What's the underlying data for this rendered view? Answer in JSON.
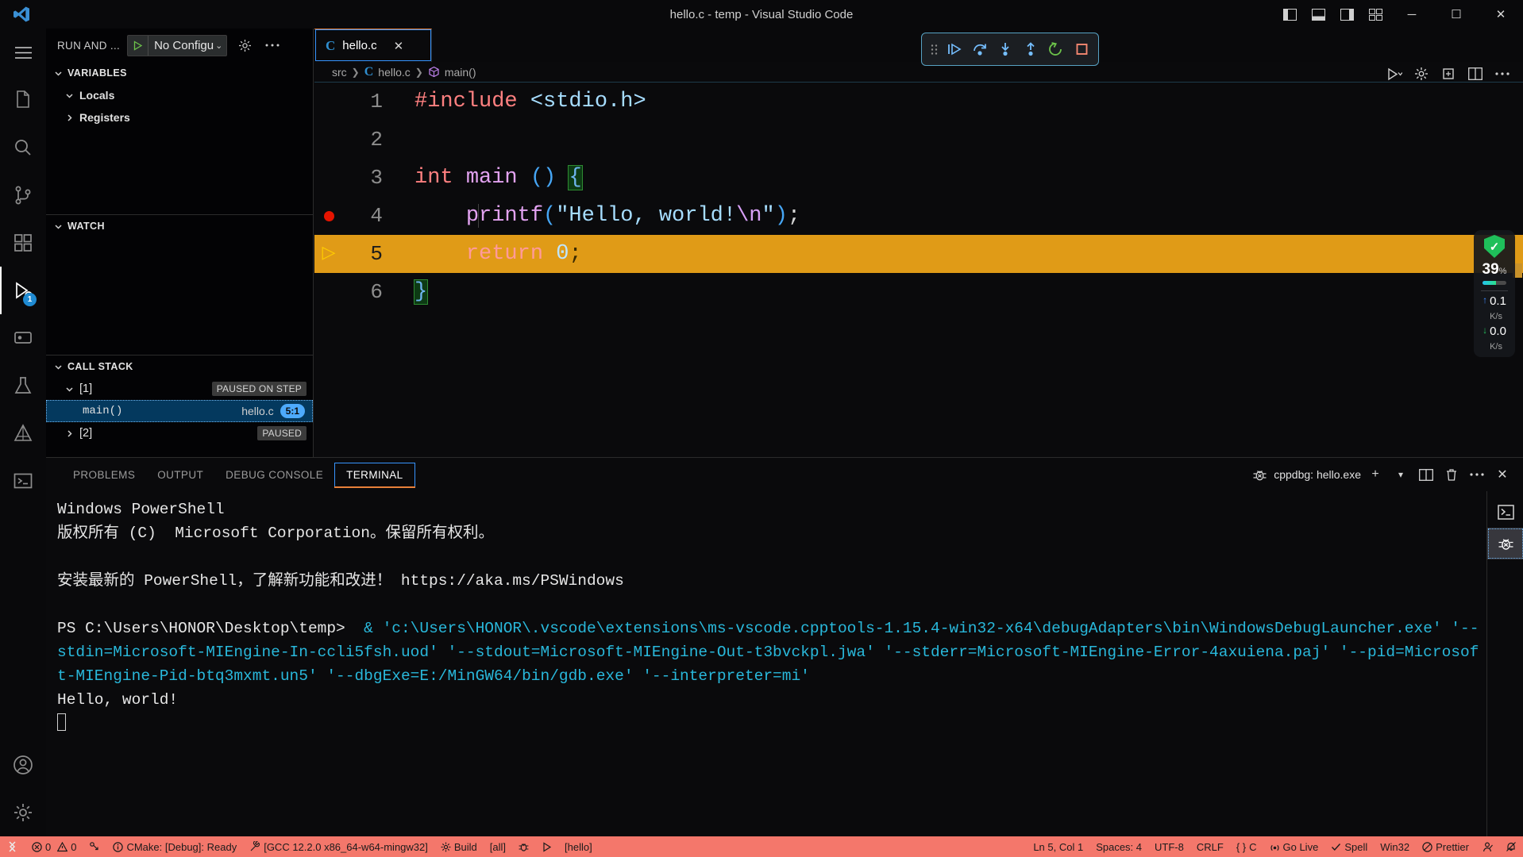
{
  "titlebar": {
    "title": "hello.c - temp - Visual Studio Code",
    "logo": "vscode-logo",
    "layout_buttons": [
      "toggle-primary-sidebar",
      "toggle-panel",
      "toggle-secondary-sidebar",
      "customize-layout"
    ],
    "window_buttons": {
      "minimize": "─",
      "maximize": "☐",
      "close": "✕"
    }
  },
  "activitybar": {
    "items": [
      {
        "name": "menu",
        "icon": "hamburger-icon"
      },
      {
        "name": "explorer",
        "icon": "files-icon"
      },
      {
        "name": "search",
        "icon": "search-icon"
      },
      {
        "name": "source-control",
        "icon": "source-control-icon"
      },
      {
        "name": "extensions",
        "icon": "extensions-icon"
      },
      {
        "name": "run-and-debug",
        "icon": "run-debug-icon",
        "badge": "1",
        "active": true
      },
      {
        "name": "remote-explorer",
        "icon": "remote-icon"
      },
      {
        "name": "testing",
        "icon": "beaker-icon"
      },
      {
        "name": "cmake",
        "icon": "cmake-icon"
      },
      {
        "name": "terminal-view",
        "icon": "terminal-icon"
      },
      {
        "name": "accounts",
        "icon": "account-icon"
      },
      {
        "name": "manage",
        "icon": "gear-icon"
      }
    ]
  },
  "sidebar": {
    "title": "RUN AND ...",
    "config": {
      "label": "No Configu",
      "play_icon": "play-icon",
      "caret": "⌄"
    },
    "header_icons": [
      "gear-icon",
      "more-actions-icon"
    ],
    "sections": [
      {
        "title": "VARIABLES",
        "rows": [
          {
            "label": "Locals",
            "expanded": true
          },
          {
            "label": "Registers",
            "expanded": false
          }
        ]
      },
      {
        "title": "WATCH",
        "rows": []
      },
      {
        "title": "CALL STACK",
        "rows": [
          {
            "label": "[1]",
            "expanded": true,
            "badge": "PAUSED ON STEP"
          },
          {
            "label": "main()",
            "file": "hello.c",
            "position": "5:1",
            "selected": true
          },
          {
            "label": "[2]",
            "expanded": false,
            "badge": "PAUSED"
          }
        ]
      }
    ]
  },
  "editor": {
    "tab": {
      "icon": "c-file-icon",
      "label": "hello.c",
      "close": "✕"
    },
    "breadcrumb": [
      "src",
      "hello.c",
      "main()"
    ],
    "breadcrumb_symbol_icon": "symbol-method-icon",
    "actions": [
      "run-or-debug-icon",
      "settings-gear-icon",
      "cmake-debug-icon",
      "split-editor-icon",
      "more-actions-icon"
    ],
    "lines": [
      {
        "num": "1",
        "marker": "",
        "tokens": [
          {
            "t": "#include ",
            "c": "t-pre"
          },
          {
            "t": "<stdio.h>",
            "c": "t-hdr"
          }
        ]
      },
      {
        "num": "2",
        "marker": "",
        "tokens": []
      },
      {
        "num": "3",
        "marker": "",
        "tokens": [
          {
            "t": "int ",
            "c": "t-kw"
          },
          {
            "t": "main ",
            "c": "t-fn"
          },
          {
            "t": "()",
            "c": "t-paren"
          },
          {
            "t": " ",
            "c": "t-punc"
          },
          {
            "t": "{",
            "c": "t-brace brace-match"
          }
        ]
      },
      {
        "num": "4",
        "marker": "breakpoint",
        "tokens": [
          {
            "t": "    ",
            "c": "t-punc"
          },
          {
            "t": "printf",
            "c": "t-fn"
          },
          {
            "t": "(",
            "c": "t-paren"
          },
          {
            "t": "\"Hello, world!",
            "c": "t-str"
          },
          {
            "t": "\\n",
            "c": "t-esc"
          },
          {
            "t": "\"",
            "c": "t-str"
          },
          {
            "t": ")",
            "c": "t-paren"
          },
          {
            "t": ";",
            "c": "t-punc"
          }
        ]
      },
      {
        "num": "5",
        "marker": "current-line-arrow",
        "highlight": true,
        "tokens": [
          {
            "t": "    ",
            "c": "t-punc"
          },
          {
            "t": "return ",
            "c": "t-kw"
          },
          {
            "t": "0",
            "c": "t-num"
          },
          {
            "t": ";",
            "c": "t-punc"
          }
        ]
      },
      {
        "num": "6",
        "marker": "",
        "tokens": [
          {
            "t": "}",
            "c": "t-brace brace-match"
          }
        ]
      }
    ]
  },
  "debug_toolbar": {
    "buttons": [
      {
        "name": "drag-handle",
        "icon": "grip-icon"
      },
      {
        "name": "continue",
        "icon": "continue-icon"
      },
      {
        "name": "step-over",
        "icon": "step-over-icon"
      },
      {
        "name": "step-into",
        "icon": "step-into-icon"
      },
      {
        "name": "step-out",
        "icon": "step-out-icon"
      },
      {
        "name": "restart",
        "icon": "restart-icon"
      },
      {
        "name": "stop",
        "icon": "stop-icon"
      }
    ]
  },
  "panel": {
    "tabs": [
      {
        "label": "PROBLEMS",
        "active": false
      },
      {
        "label": "OUTPUT",
        "active": false
      },
      {
        "label": "DEBUG CONSOLE",
        "active": false
      },
      {
        "label": "TERMINAL",
        "active": true
      }
    ],
    "session": {
      "icon": "debug-console-icon",
      "label": "cppdbg: hello.exe"
    },
    "actions": [
      "new-terminal-icon",
      "terminal-profile-chevron-icon",
      "split-terminal-icon",
      "kill-terminal-icon",
      "more-actions-icon",
      "close-panel-icon"
    ],
    "side_items": [
      {
        "name": "powershell-terminal",
        "icon": "terminal-icon",
        "active": false
      },
      {
        "name": "cppdbg-terminal",
        "icon": "debug-console-icon",
        "active": true
      }
    ],
    "terminal": {
      "line1": "Windows PowerShell",
      "line2": "版权所有 (C)  Microsoft Corporation。保留所有权利。",
      "line3": "",
      "line4": "安装最新的 PowerShell，了解新功能和改进！ https://aka.ms/PSWindows",
      "line5": "",
      "prompt": "PS C:\\Users\\HONOR\\Desktop\\temp> ",
      "command": " & 'c:\\Users\\HONOR\\.vscode\\extensions\\ms-vscode.cpptools-1.15.4-win32-x64\\debugAdapters\\bin\\WindowsDebugLauncher.exe' '--stdin=Microsoft-MIEngine-In-ccli5fsh.uod' '--stdout=Microsoft-MIEngine-Out-t3bvckpl.jwa' '--stderr=Microsoft-MIEngine-Error-4axuiena.paj' '--pid=Microsoft-MIEngine-Pid-btq3mxmt.un5' '--dbgExe=E:/MinGW64/bin/gdb.exe' '--interpreter=mi'",
      "output": "Hello, world!"
    }
  },
  "statusbar": {
    "left": [
      {
        "name": "remote-window",
        "icon": "remote-icon",
        "label": ""
      },
      {
        "name": "problems",
        "icon": "error-icon",
        "label": "0",
        "icon2": "warning-icon",
        "label2": "0"
      },
      {
        "name": "live-share",
        "icon": "live-share-icon",
        "label": ""
      },
      {
        "name": "cmake-status",
        "icon": "info-icon",
        "label": "CMake: [Debug]: Ready"
      },
      {
        "name": "cmake-kit",
        "icon": "tools-icon",
        "label": "[GCC 12.2.0 x86_64-w64-mingw32]"
      },
      {
        "name": "cmake-build",
        "icon": "gear-icon",
        "label": "Build"
      },
      {
        "name": "cmake-target-all",
        "icon": "",
        "label": "[all]"
      },
      {
        "name": "cmake-debug",
        "icon": "bug-icon",
        "label": ""
      },
      {
        "name": "cmake-launch",
        "icon": "play-icon",
        "label": ""
      },
      {
        "name": "cmake-launch-target",
        "icon": "",
        "label": "[hello]"
      }
    ],
    "right": [
      {
        "name": "editor-position",
        "icon": "",
        "label": "Ln 5, Col 1"
      },
      {
        "name": "indentation",
        "icon": "",
        "label": "Spaces: 4"
      },
      {
        "name": "encoding",
        "icon": "",
        "label": "UTF-8"
      },
      {
        "name": "eol",
        "icon": "",
        "label": "CRLF"
      },
      {
        "name": "language-mode",
        "icon": "brackets-icon",
        "label": "C"
      },
      {
        "name": "go-live",
        "icon": "broadcast-icon",
        "label": "Go Live"
      },
      {
        "name": "spell-checker",
        "icon": "check-icon",
        "label": "Spell"
      },
      {
        "name": "win32",
        "icon": "",
        "label": "Win32"
      },
      {
        "name": "prettier",
        "icon": "prettier-icon",
        "label": "Prettier"
      },
      {
        "name": "screencast",
        "icon": "person-icon",
        "label": ""
      },
      {
        "name": "notifications",
        "icon": "bell-dot-icon",
        "label": ""
      }
    ]
  },
  "security_widget": {
    "shield_icon": "shield-check-icon",
    "percent": "39",
    "percent_unit": "%",
    "progress": 55,
    "upload": {
      "value": "0.1",
      "unit": "K/s",
      "arrow": "↑"
    },
    "download": {
      "value": "0.0",
      "unit": "K/s",
      "arrow": "↓"
    }
  },
  "colors": {
    "accent": "#3794ff",
    "debug_statusbar": "#f4776b",
    "highlight_line": "#e09b17",
    "breakpoint": "#e51400"
  }
}
